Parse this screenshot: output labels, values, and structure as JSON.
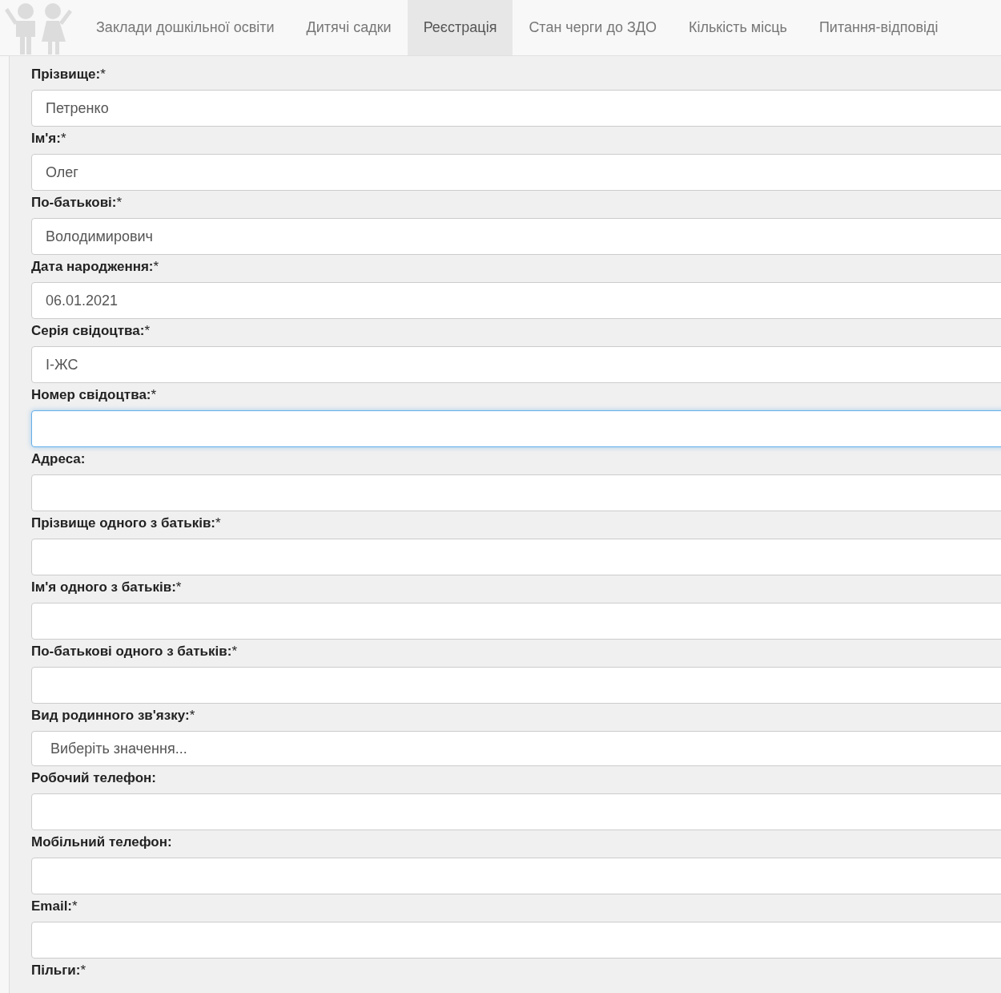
{
  "nav": {
    "tabs": [
      {
        "label": "Заклади дошкільної освіти",
        "selected": false
      },
      {
        "label": "Дитячі садки",
        "selected": false
      },
      {
        "label": "Реєстрація",
        "selected": true
      },
      {
        "label": "Стан черги до ЗДО",
        "selected": false
      },
      {
        "label": "Кількість місць",
        "selected": false
      },
      {
        "label": "Питання-відповіді",
        "selected": false
      }
    ]
  },
  "form": {
    "fields": [
      {
        "kind": "text",
        "label": "Прізвище:",
        "required_mark": "*",
        "value": "Петренко",
        "focused": false
      },
      {
        "kind": "text",
        "label": "Ім'я:",
        "required_mark": "*",
        "value": "Олег",
        "focused": false
      },
      {
        "kind": "text",
        "label": "По-батькові:",
        "required_mark": "*",
        "value": "Володимирович",
        "focused": false
      },
      {
        "kind": "text",
        "label": "Дата народження:",
        "required_mark": "*",
        "value": "06.01.2021",
        "focused": false
      },
      {
        "kind": "text",
        "label": "Серія свідоцтва:",
        "required_mark": "*",
        "value": "І-ЖС",
        "focused": false
      },
      {
        "kind": "text",
        "label": "Номер свідоцтва:",
        "required_mark": "*",
        "focused": true
      },
      {
        "kind": "text",
        "label": "Адреса:",
        "focused": false
      },
      {
        "kind": "text",
        "label": "Прізвище одного з батьків:",
        "required_mark": "*",
        "focused": false
      },
      {
        "kind": "text",
        "label": "Ім'я одного з батьків:",
        "required_mark": "*",
        "focused": false
      },
      {
        "kind": "text",
        "label": "По-батькові одного з батьків:",
        "required_mark": "*",
        "focused": false
      },
      {
        "kind": "select",
        "label": "Вид родинного зв'язку:",
        "required_mark": "*",
        "placeholder": "Виберіть значення...",
        "focused": false
      },
      {
        "kind": "text",
        "label": "Робочий телефон:",
        "focused": false
      },
      {
        "kind": "text",
        "label": "Мобільний телефон:",
        "focused": false
      },
      {
        "kind": "text",
        "label": "Email:",
        "required_mark": "*",
        "focused": false
      },
      {
        "kind": "label_only",
        "label": "Пільги:",
        "required_mark": "*"
      }
    ]
  }
}
